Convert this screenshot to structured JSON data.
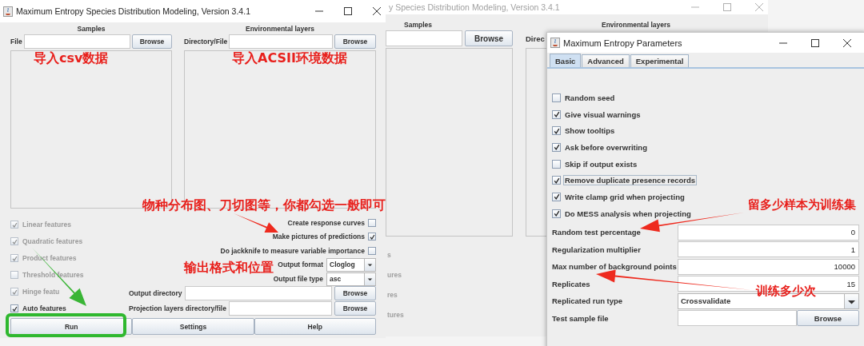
{
  "main_window": {
    "title": "Maximum Entropy Species Distribution Modeling, Version 3.4.1",
    "samples": {
      "heading": "Samples",
      "label": "File",
      "browse": "Browse"
    },
    "layers": {
      "heading": "Environmental layers",
      "label": "Directory/File",
      "browse": "Browse"
    },
    "features": [
      {
        "label": "Linear features",
        "checked": true,
        "disabled": true
      },
      {
        "label": "Quadratic features",
        "checked": true,
        "disabled": true
      },
      {
        "label": "Product features",
        "checked": true,
        "disabled": true
      },
      {
        "label": "Threshold features",
        "checked": false,
        "disabled": true
      },
      {
        "label": "Hinge featu",
        "checked": true,
        "disabled": true
      },
      {
        "label": "Auto features",
        "checked": true,
        "disabled": false
      }
    ],
    "options": [
      {
        "label": "Create response curves",
        "checked": false
      },
      {
        "label": "Make pictures of predictions",
        "checked": true
      },
      {
        "label": "Do jackknife to measure variable importance",
        "checked": false
      }
    ],
    "selects": [
      {
        "label": "Output format",
        "value": "Cloglog"
      },
      {
        "label": "Output file type",
        "value": "asc"
      }
    ],
    "paths": [
      {
        "label": "Output directory",
        "browse": "Browse"
      },
      {
        "label": "Projection layers directory/file",
        "browse": "Browse"
      }
    ],
    "buttons": [
      "Run",
      "Settings",
      "Help"
    ]
  },
  "background_window": {
    "title": "y Species Distribution Modeling, Version 3.4.1",
    "samples_heading": "Samples",
    "browse": "Browse",
    "layers_heading": "Environmental layers",
    "directory_label": "Direc",
    "feature_fragments": [
      "s",
      "ures",
      "res",
      "tures"
    ]
  },
  "parameters_dialog": {
    "title": "Maximum Entropy Parameters",
    "tabs": [
      {
        "label": "Basic",
        "selected": true
      },
      {
        "label": "Advanced",
        "selected": false
      },
      {
        "label": "Experimental",
        "selected": false
      }
    ],
    "checkboxes": [
      {
        "label": "Random seed",
        "checked": false,
        "focused": false
      },
      {
        "label": "Give visual warnings",
        "checked": true,
        "focused": false
      },
      {
        "label": "Show tooltips",
        "checked": true,
        "focused": false
      },
      {
        "label": "Ask before overwriting",
        "checked": true,
        "focused": false
      },
      {
        "label": "Skip if output exists",
        "checked": false,
        "focused": false
      },
      {
        "label": "Remove duplicate presence records",
        "checked": true,
        "focused": true
      },
      {
        "label": "Write clamp grid when projecting",
        "checked": true,
        "focused": false
      },
      {
        "label": "Do MESS analysis when projecting",
        "checked": true,
        "focused": false
      }
    ],
    "fields": [
      {
        "kind": "text",
        "label": "Random test percentage",
        "value": "0"
      },
      {
        "kind": "text",
        "label": "Regularization multiplier",
        "value": "1"
      },
      {
        "kind": "text",
        "label": "Max number of background points",
        "value": "10000"
      },
      {
        "kind": "text",
        "label": "Replicates",
        "value": "15"
      },
      {
        "kind": "dropdown",
        "label": "Replicated run type",
        "value": "Crossvalidate"
      },
      {
        "kind": "file",
        "label": "Test sample file",
        "browse": "Browse"
      }
    ]
  },
  "annotations": [
    {
      "text": "导入csv数据"
    },
    {
      "text": "导入ACSII环境数据"
    },
    {
      "text": "物种分布图、刀切图等，你都勾选一般即可"
    },
    {
      "text": "输出格式和位置"
    },
    {
      "text": "留多少样本为训练集"
    },
    {
      "text": "训练多少次"
    }
  ]
}
